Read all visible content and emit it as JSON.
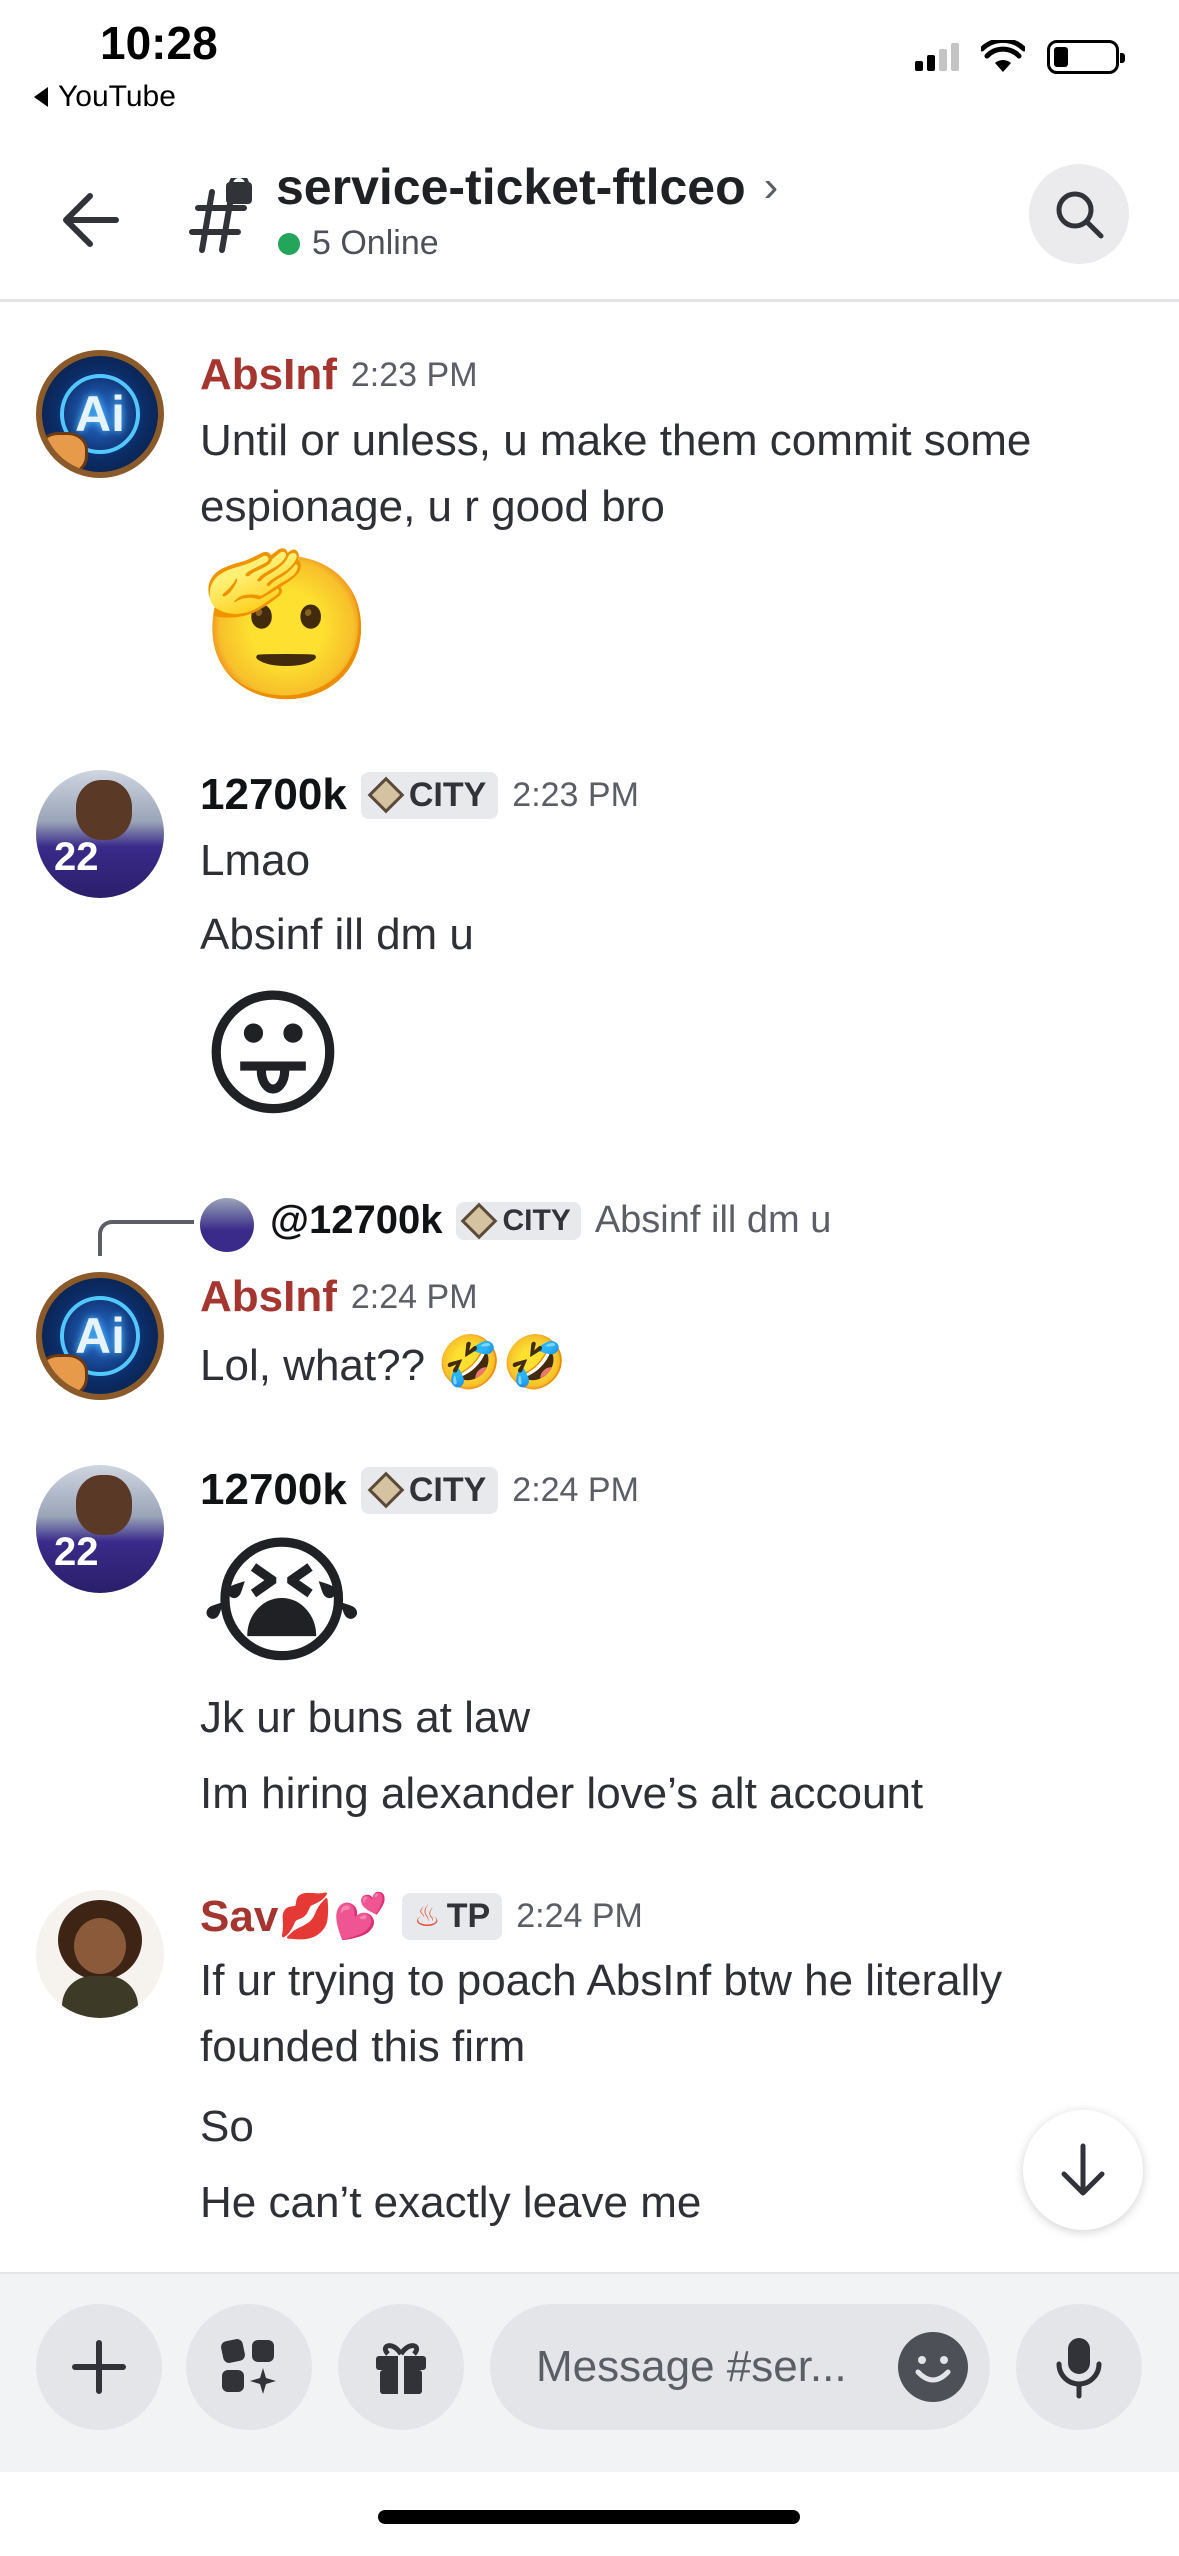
{
  "status_bar": {
    "time": "10:28",
    "back_app": "YouTube"
  },
  "header": {
    "channel_name": "service-ticket-ftlceo",
    "online_text": "5 Online"
  },
  "messages": [
    {
      "author": "AbsInf",
      "time": "2:23 PM",
      "lines": [
        "Until or unless, u make them commit some espionage, u r good bro"
      ],
      "emoji": "🫡"
    },
    {
      "author": "12700k",
      "tag": "CITY",
      "time": "2:23 PM",
      "lines": [
        "Lmao",
        "Absinf ill dm u"
      ],
      "emoji": "😛"
    },
    {
      "reply_to": {
        "author": "@12700k",
        "tag": "CITY",
        "text": "Absinf ill dm u"
      },
      "author": "AbsInf",
      "time": "2:24 PM",
      "lines": [
        "Lol, what??"
      ],
      "inline_emoji": "🤣🤣"
    },
    {
      "author": "12700k",
      "tag": "CITY",
      "time": "2:24 PM",
      "emoji": "😭",
      "lines": [
        "Jk ur buns at law",
        "Im hiring alexander love’s alt account"
      ]
    },
    {
      "author": "Sav💋💕",
      "tag": "TP",
      "time": "2:24 PM",
      "lines": [
        "If ur trying to poach AbsInf btw he literally founded this firm",
        "So",
        "He can’t exactly leave me"
      ]
    }
  ],
  "composer": {
    "placeholder": "Message #ser..."
  },
  "icons": [
    "back-arrow-icon",
    "channel-lock-icon",
    "search-icon",
    "plus-icon",
    "apps-icon",
    "gift-icon",
    "emoji-icon",
    "mic-icon",
    "arrow-down-icon"
  ]
}
